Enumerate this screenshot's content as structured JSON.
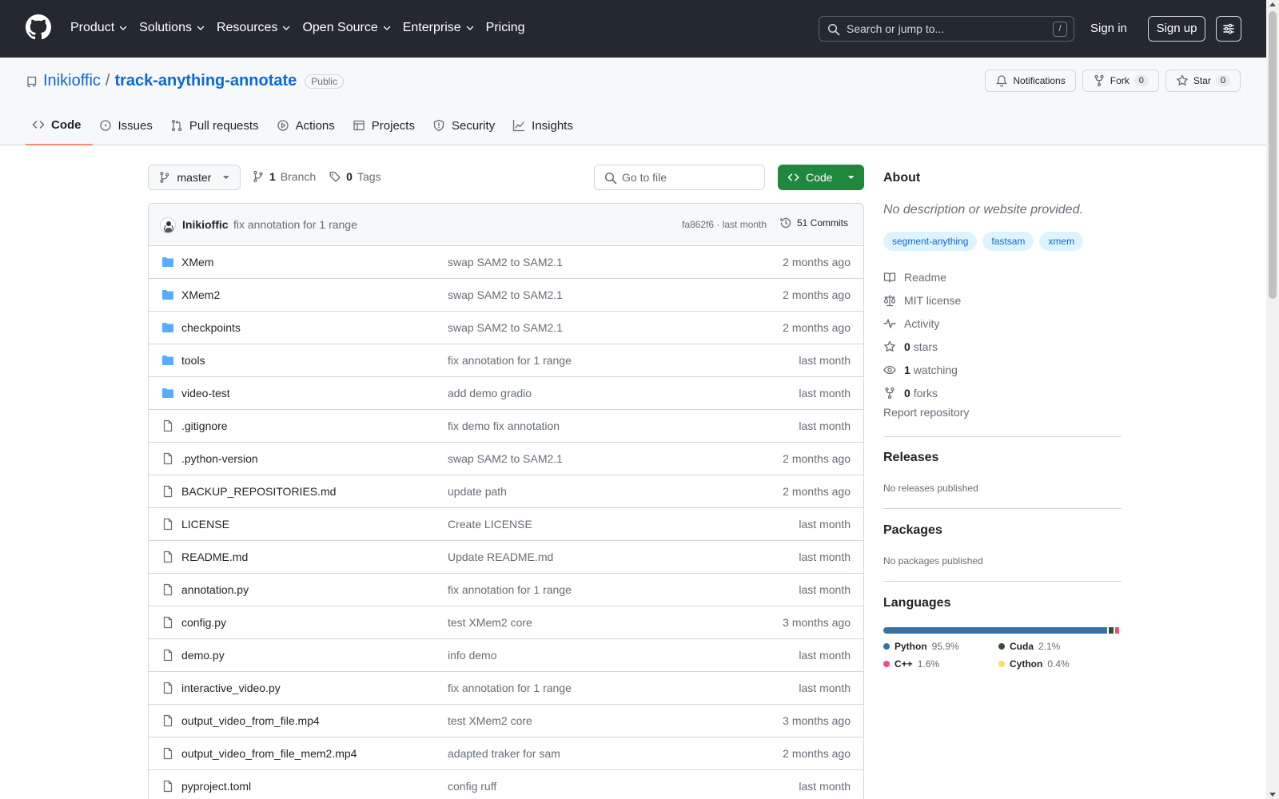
{
  "header": {
    "nav": [
      {
        "label": "Product",
        "has_menu": true
      },
      {
        "label": "Solutions",
        "has_menu": true
      },
      {
        "label": "Resources",
        "has_menu": true
      },
      {
        "label": "Open Source",
        "has_menu": true
      },
      {
        "label": "Enterprise",
        "has_menu": true
      },
      {
        "label": "Pricing",
        "has_menu": false
      }
    ],
    "search_placeholder": "Search or jump to...",
    "search_shortcut": "/",
    "signin": "Sign in",
    "signup": "Sign up"
  },
  "repo": {
    "owner": "Inikioffic",
    "separator": "/",
    "name": "track-anything-annotate",
    "visibility": "Public",
    "notifications_label": "Notifications",
    "fork_label": "Fork",
    "fork_count": "0",
    "star_label": "Star",
    "star_count": "0"
  },
  "tabs": [
    {
      "label": "Code",
      "icon": "code-icon",
      "active": true
    },
    {
      "label": "Issues",
      "icon": "issue-icon",
      "active": false
    },
    {
      "label": "Pull requests",
      "icon": "pull-request-icon",
      "active": false
    },
    {
      "label": "Actions",
      "icon": "play-icon",
      "active": false
    },
    {
      "label": "Projects",
      "icon": "table-icon",
      "active": false
    },
    {
      "label": "Security",
      "icon": "shield-icon",
      "active": false
    },
    {
      "label": "Insights",
      "icon": "graph-icon",
      "active": false
    }
  ],
  "toolbar": {
    "branch": "master",
    "branch_count": "1",
    "branch_label": "Branch",
    "tag_count": "0",
    "tag_label": "Tags",
    "goto_placeholder": "Go to file",
    "code_button": "Code"
  },
  "latest_commit": {
    "author": "Inikioffic",
    "message": "fix annotation for 1 range",
    "hash_time": "fa862f6 · last month",
    "commits": "51 Commits"
  },
  "files": [
    {
      "name": "XMem",
      "type": "dir",
      "message": "swap SAM2 to SAM2.1",
      "date": "2 months ago"
    },
    {
      "name": "XMem2",
      "type": "dir",
      "message": "swap SAM2 to SAM2.1",
      "date": "2 months ago"
    },
    {
      "name": "checkpoints",
      "type": "dir",
      "message": "swap SAM2 to SAM2.1",
      "date": "2 months ago"
    },
    {
      "name": "tools",
      "type": "dir",
      "message": "fix annotation for 1 range",
      "date": "last month"
    },
    {
      "name": "video-test",
      "type": "dir",
      "message": "add demo gradio",
      "date": "last month"
    },
    {
      "name": ".gitignore",
      "type": "file",
      "message": "fix demo fix annotation",
      "date": "last month"
    },
    {
      "name": ".python-version",
      "type": "file",
      "message": "swap SAM2 to SAM2.1",
      "date": "2 months ago"
    },
    {
      "name": "BACKUP_REPOSITORIES.md",
      "type": "file",
      "message": "update path",
      "date": "2 months ago"
    },
    {
      "name": "LICENSE",
      "type": "file",
      "message": "Create LICENSE",
      "date": "last month"
    },
    {
      "name": "README.md",
      "type": "file",
      "message": "Update README.md",
      "date": "last month"
    },
    {
      "name": "annotation.py",
      "type": "file",
      "message": "fix annotation for 1 range",
      "date": "last month"
    },
    {
      "name": "config.py",
      "type": "file",
      "message": "test XMem2 core",
      "date": "3 months ago"
    },
    {
      "name": "demo.py",
      "type": "file",
      "message": "info demo",
      "date": "last month"
    },
    {
      "name": "interactive_video.py",
      "type": "file",
      "message": "fix annotation for 1 range",
      "date": "last month"
    },
    {
      "name": "output_video_from_file.mp4",
      "type": "file",
      "message": "test XMem2 core",
      "date": "3 months ago"
    },
    {
      "name": "output_video_from_file_mem2.mp4",
      "type": "file",
      "message": "adapted traker for sam",
      "date": "2 months ago"
    },
    {
      "name": "pyproject.toml",
      "type": "file",
      "message": "config ruff",
      "date": "last month"
    }
  ],
  "about": {
    "title": "About",
    "description": "No description or website provided.",
    "topics": [
      "segment-anything",
      "fastsam",
      "xmem"
    ],
    "items": [
      {
        "icon": "book-icon",
        "count": "",
        "label": "Readme"
      },
      {
        "icon": "law-icon",
        "count": "",
        "label": "MIT license"
      },
      {
        "icon": "pulse-icon",
        "count": "",
        "label": "Activity"
      },
      {
        "icon": "star-icon",
        "count": "0",
        "label": "stars"
      },
      {
        "icon": "eye-icon",
        "count": "1",
        "label": "watching"
      },
      {
        "icon": "fork-icon",
        "count": "0",
        "label": "forks"
      }
    ],
    "report": "Report repository"
  },
  "releases": {
    "title": "Releases",
    "text": "No releases published"
  },
  "packages": {
    "title": "Packages",
    "text": "No packages published"
  },
  "languages": {
    "title": "Languages",
    "items": [
      {
        "name": "Python",
        "percent": "95.9%",
        "value": 95.9,
        "color": "#3572A5"
      },
      {
        "name": "Cuda",
        "percent": "2.1%",
        "value": 2.1,
        "color": "#3A4E3A"
      },
      {
        "name": "C++",
        "percent": "1.6%",
        "value": 1.6,
        "color": "#f34b7d"
      },
      {
        "name": "Cython",
        "percent": "0.4%",
        "value": 0.4,
        "color": "#fedf5b"
      }
    ]
  }
}
